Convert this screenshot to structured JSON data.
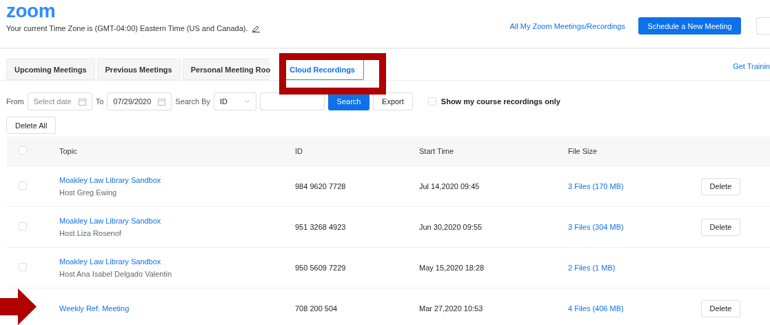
{
  "header": {
    "logo": "zoom",
    "timezone": "Your current Time Zone is (GMT-04:00) Eastern Time (US and Canada).",
    "all_link": "All My Zoom Meetings/Recordings",
    "schedule_button": "Schedule a New Meeting"
  },
  "tabs": [
    {
      "label": "Upcoming Meetings",
      "selected": false
    },
    {
      "label": "Previous Meetings",
      "selected": false
    },
    {
      "label": "Personal Meeting Roo",
      "selected": false
    },
    {
      "label": "Cloud Recordings",
      "selected": true
    }
  ],
  "training_link": "Get Trainin",
  "filters": {
    "from_label": "From",
    "from_placeholder": "Select date",
    "to_label": "To",
    "to_value": "07/29/2020",
    "search_by_label": "Search By",
    "search_by_value": "ID",
    "search_button": "Search",
    "export_button": "Export",
    "course_only": {
      "label": "Show my course recordings only",
      "checked": false
    }
  },
  "delete_all": "Delete All",
  "table": {
    "select_all_checked": false,
    "columns": [
      "Topic",
      "ID",
      "Start Time",
      "File Size"
    ],
    "rows": [
      {
        "checked": false,
        "topic": "Moakley Law Library Sandbox",
        "host": "Host Greg Ewing",
        "id": "984 9620 7728",
        "start": "Jul 14,2020 09:45",
        "size": "3 Files (170 MB)",
        "action": "Delete"
      },
      {
        "checked": false,
        "topic": "Moakley Law Library Sandbox",
        "host": "Host Liza Rosenof",
        "id": "951 3268 4923",
        "start": "Jun 30,2020 09:55",
        "size": "3 Files (304 MB)",
        "action": "Delete"
      },
      {
        "checked": false,
        "topic": "Moakley Law Library Sandbox",
        "host": "Host Ana Isabel Delgado Valentin",
        "id": "950 5609 7229",
        "start": "May 15,2020 18:28",
        "size": "2 Files (1 MB)"
      },
      {
        "topic": "Weekly Ref. Meeting",
        "id": "708 200 504",
        "start": "Mar 27,2020 10:53",
        "size": "4 Files (406 MB)",
        "action": "Delete"
      }
    ]
  }
}
